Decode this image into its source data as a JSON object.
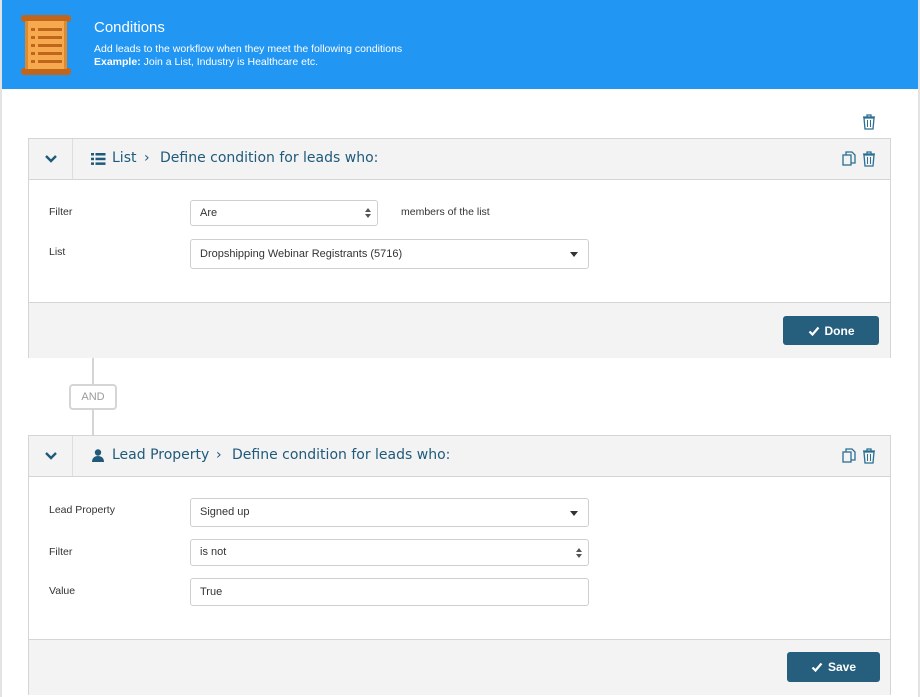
{
  "header": {
    "title": "Conditions",
    "subtitle": "Add leads to the workflow when they meet the following conditions",
    "example_label": "Example:",
    "example_text": " Join a List, Industry is Healthcare etc.",
    "icon": "scroll-list-icon"
  },
  "global_delete_icon": "trash-icon",
  "conditions": [
    {
      "type_icon": "list-icon",
      "type_label": "List",
      "separator": "›",
      "heading": "Define condition for leads who:",
      "fields": [
        {
          "label": "Filter",
          "value": "Are",
          "suffix": "members of the list"
        },
        {
          "label": "List",
          "value": "Dropshipping Webinar Registrants (5716)"
        }
      ],
      "button_label": "Done"
    },
    {
      "type_icon": "user-icon",
      "type_label": "Lead Property",
      "separator": "›",
      "heading": "Define condition for leads who:",
      "fields": [
        {
          "label": "Lead Property",
          "value": "Signed up"
        },
        {
          "label": "Filter",
          "value": "is not"
        },
        {
          "label": "Value",
          "value": "True"
        }
      ],
      "button_label": "Save"
    }
  ],
  "connector": "AND",
  "colors": {
    "header_bg": "#2196f3",
    "link": "#1f5a7a",
    "button_bg": "#265e7d",
    "panel_bg": "#f3f3f3"
  }
}
